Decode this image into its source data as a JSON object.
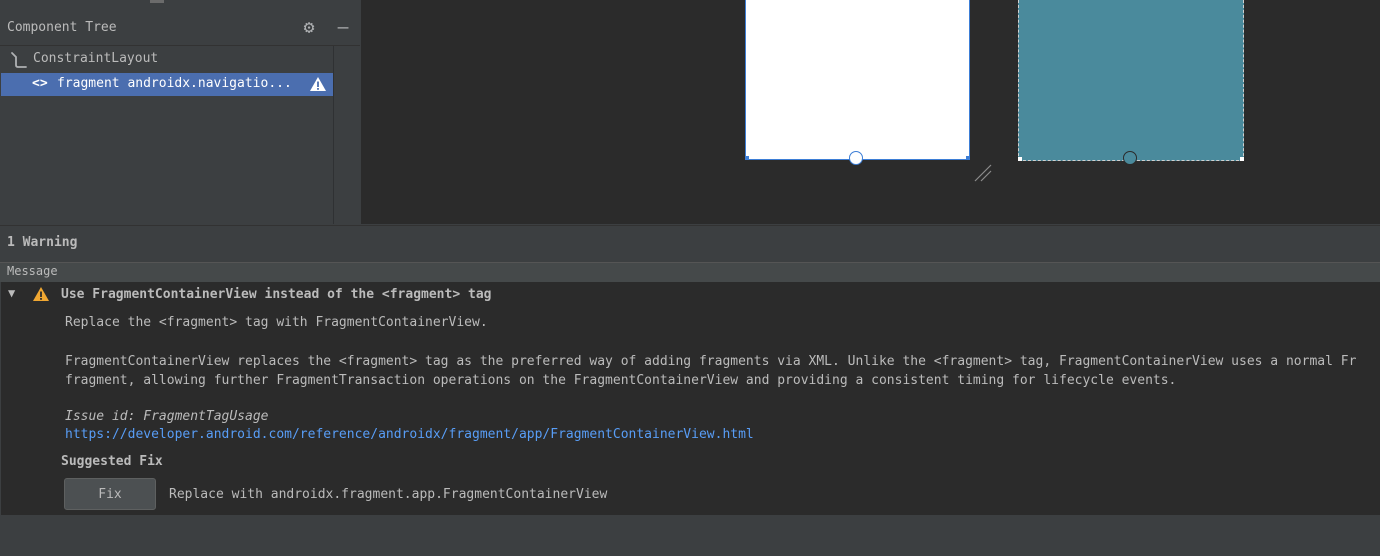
{
  "component_tree": {
    "title": "Component Tree",
    "items": [
      {
        "label": "ConstraintLayout",
        "icon": "constraint-layout-icon"
      },
      {
        "label": "fragment androidx.navigatio...",
        "icon": "code-tag-icon",
        "selected": true,
        "warning": true
      }
    ]
  },
  "warnings": {
    "count_label": "1 Warning",
    "column_header": "Message",
    "issue": {
      "title": "Use FragmentContainerView instead of the <fragment> tag",
      "summary": "Replace the <fragment> tag with FragmentContainerView.",
      "description_line1": "FragmentContainerView replaces the <fragment> tag as the preferred way of adding fragments via XML. Unlike the <fragment> tag, FragmentContainerView uses a normal Fr",
      "description_line2": "fragment, allowing further FragmentTransaction operations on the FragmentContainerView and providing a consistent timing for lifecycle events.",
      "issue_id": "Issue id: FragmentTagUsage",
      "link": "https://developer.android.com/reference/androidx/fragment/app/FragmentContainerView.html",
      "suggested_fix_label": "Suggested Fix",
      "fix_button": "Fix",
      "fix_description": "Replace with androidx.fragment.app.FragmentContainerView"
    }
  },
  "colors": {
    "selection": "#4b6eaf",
    "link": "#589df6",
    "warning": "#f0a732",
    "blueprint": "#4a8a9c"
  }
}
